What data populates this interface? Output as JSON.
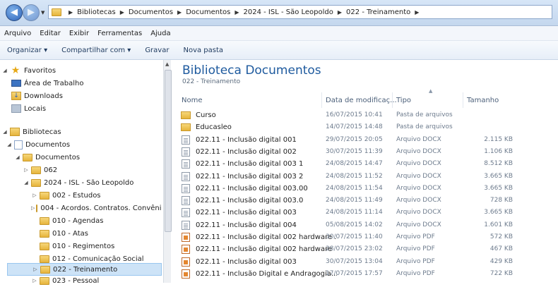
{
  "address": {
    "crumbs": [
      "Bibliotecas",
      "Documentos",
      "Documentos",
      "2024 - ISL - São Leopoldo",
      "022 - Treinamento"
    ]
  },
  "menu": [
    "Arquivo",
    "Editar",
    "Exibir",
    "Ferramentas",
    "Ajuda"
  ],
  "toolbar": {
    "organize": "Organizar ▾",
    "share": "Compartilhar com ▾",
    "burn": "Gravar",
    "new_folder": "Nova pasta"
  },
  "nav": {
    "favorites": "Favoritos",
    "desktop": "Área de Trabalho",
    "downloads": "Downloads",
    "places": "Locais",
    "libraries": "Bibliotecas",
    "documents": "Documentos",
    "documents_sub": "Documentos",
    "f062": "062",
    "f2024": "2024 - ISL - São Leopoldo",
    "f002": "002 - Estudos",
    "f004": "004 - Acordos. Contratos. Convênios",
    "f010a": "010 - Agendas",
    "f010b": "010 - Atas",
    "f010c": "010 - Regimentos",
    "f012": "012 - Comunicação Social",
    "f022": "022 - Treinamento",
    "f023": "023 - Pessoal"
  },
  "library": {
    "title": "Biblioteca Documentos",
    "subtitle": "022 - Treinamento"
  },
  "columns": {
    "name": "Nome",
    "date": "Data de modificaç...",
    "type": "Tipo",
    "size": "Tamanho"
  },
  "files": [
    {
      "name": "Curso",
      "date": "16/07/2015 10:41",
      "type": "Pasta de arquivos",
      "size": "",
      "icon": "folder-icon"
    },
    {
      "name": "Educasleo",
      "date": "14/07/2015 14:48",
      "type": "Pasta de arquivos",
      "size": "",
      "icon": "folder-icon"
    },
    {
      "name": "022.11 - Inclusão digital 001",
      "date": "29/07/2015 20:05",
      "type": "Arquivo DOCX",
      "size": "2.115 KB",
      "icon": "docx-icon"
    },
    {
      "name": "022.11 - Inclusão digital 002",
      "date": "30/07/2015 11:39",
      "type": "Arquivo DOCX",
      "size": "1.106 KB",
      "icon": "docx-icon"
    },
    {
      "name": "022.11 - Inclusão digital 003 1",
      "date": "24/08/2015 14:47",
      "type": "Arquivo DOCX",
      "size": "8.512 KB",
      "icon": "docx-icon"
    },
    {
      "name": "022.11 - Inclusão digital 003 2",
      "date": "24/08/2015 11:52",
      "type": "Arquivo DOCX",
      "size": "3.665 KB",
      "icon": "docx-icon"
    },
    {
      "name": "022.11 - Inclusão digital 003.00",
      "date": "24/08/2015 11:54",
      "type": "Arquivo DOCX",
      "size": "3.665 KB",
      "icon": "docx-icon"
    },
    {
      "name": "022.11 - Inclusão digital 003.0",
      "date": "24/08/2015 11:49",
      "type": "Arquivo DOCX",
      "size": "728 KB",
      "icon": "docx-icon"
    },
    {
      "name": "022.11 - Inclusão digital 003",
      "date": "24/08/2015 11:14",
      "type": "Arquivo DOCX",
      "size": "3.665 KB",
      "icon": "docx-icon"
    },
    {
      "name": "022.11 - Inclusão digital 004",
      "date": "05/08/2015 14:02",
      "type": "Arquivo DOCX",
      "size": "1.601 KB",
      "icon": "docx-icon"
    },
    {
      "name": "022.11 - Inclusão digital 002 hardware ...",
      "date": "30/07/2015 11:40",
      "type": "Arquivo PDF",
      "size": "572 KB",
      "icon": "pdf-icon"
    },
    {
      "name": "022.11 - Inclusão digital 002 hardware",
      "date": "28/07/2015 23:02",
      "type": "Arquivo PDF",
      "size": "467 KB",
      "icon": "pdf-icon"
    },
    {
      "name": "022.11 - Inclusão digital 003",
      "date": "30/07/2015 13:04",
      "type": "Arquivo PDF",
      "size": "429 KB",
      "icon": "pdf-icon"
    },
    {
      "name": "022.11 - Inclusão Digital e Andragogia...",
      "date": "17/07/2015 17:57",
      "type": "Arquivo PDF",
      "size": "722 KB",
      "icon": "pdf-icon"
    }
  ]
}
